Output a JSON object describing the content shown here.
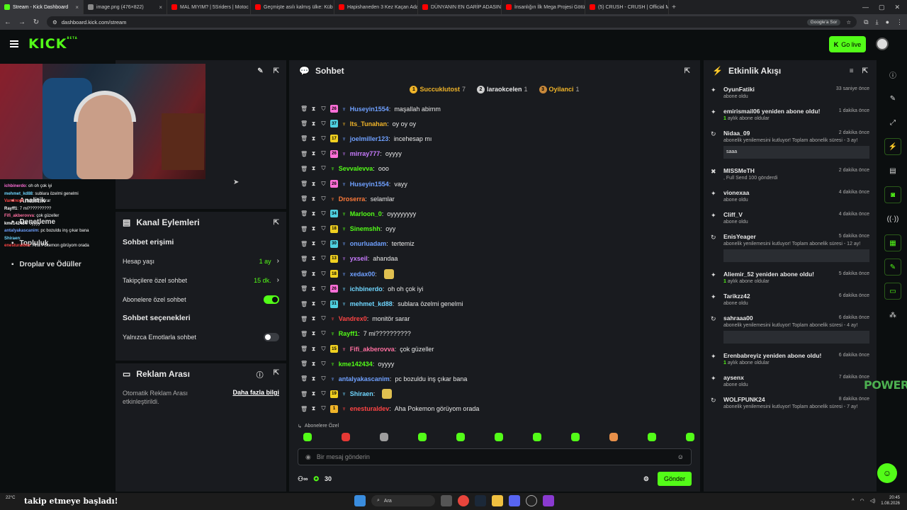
{
  "browser": {
    "tabs": [
      {
        "title": "Stream - Kick Dashboard",
        "color": "#53fc18",
        "active": true
      },
      {
        "title": "image.png (476×822)",
        "color": "#888888",
        "active": false
      },
      {
        "title": "MAL MIYIM? | 5Sriders | Motoc",
        "color": "#ff0000",
        "active": false
      },
      {
        "title": "Geçmişte asılı kalmış ülke: Küb",
        "color": "#ff0000",
        "active": false
      },
      {
        "title": "Hapishaneden 3 Kez Kaçan Ada",
        "color": "#ff0000",
        "active": false
      },
      {
        "title": "DÜNYANIN EN GARİP ADASINI",
        "color": "#ff0000",
        "active": false
      },
      {
        "title": "İnsanlığın İlk Mega Projesi Götü",
        "color": "#ff0000",
        "active": false
      },
      {
        "title": "(5) CRUSH - CRUSH | Official M",
        "color": "#ff0000",
        "active": false
      }
    ],
    "url": "dashboard.kick.com/stream",
    "google_sor": "Google'a Sor"
  },
  "header": {
    "logo": "KICK",
    "logo_sup": "BETA",
    "go_live": "Go live"
  },
  "left_menu": [
    "Analitik",
    "Denetleme",
    "Topluluk",
    "Droplar ve Ödüller"
  ],
  "overlay_chat": [
    {
      "user": "ichbinerdo",
      "text": "oh oh çok iyi",
      "color": "#ff6fd8"
    },
    {
      "user": "mehmet_kd88",
      "text": "sublara özelmi genelmi",
      "color": "#6fd6ff"
    },
    {
      "user": "Vandrex0",
      "text": "monitör sarar",
      "color": "#ff4444"
    },
    {
      "user": "Rayff1",
      "text": "7 mi??????????",
      "color": "#ffffff"
    },
    {
      "user": "Fifi_akberovva",
      "text": "çok güzeller",
      "color": "#ff6fa0"
    },
    {
      "user": "kme142434",
      "text": "oyyyy",
      "color": "#ffffff"
    },
    {
      "user": "antalyakascanim",
      "text": "pc bozuldu inş çıkar bana",
      "color": "#6fa0ff"
    },
    {
      "user": "Shiraen",
      "text": "",
      "color": "#6fd6ff"
    },
    {
      "user": "enesturaldev",
      "text": "Aha Pokemon görüyom orada",
      "color": "#ff4444"
    }
  ],
  "channel_actions": {
    "title": "Kanal Eylemleri",
    "chat_access": "Sohbet erişimi",
    "account_age_label": "Hesap yaşı",
    "account_age_value": "1 ay",
    "followers_label": "Takipçilere özel sohbet",
    "followers_value": "15 dk.",
    "subs_label": "Abonelere özel sohbet",
    "chat_options": "Sohbet seçenekleri",
    "emote_only_label": "Yalnızca Emotlarla sohbet"
  },
  "ad_break": {
    "title": "Reklam Arası",
    "desc": "Otomatik Reklam Arası etkinleştirildi.",
    "link": "Daha fazla bilgi"
  },
  "chat": {
    "title": "Sohbet",
    "gifters": [
      {
        "rank": "1",
        "name": "Succuklutost",
        "count": "7",
        "color": "#f0b429",
        "name_color": "#f0b429"
      },
      {
        "rank": "2",
        "name": "laraokcelen",
        "count": "1",
        "color": "#cfcfcf",
        "name_color": "#e8e8e8"
      },
      {
        "rank": "3",
        "name": "Oyilanci",
        "count": "1",
        "color": "#c8883a",
        "name_color": "#f0b429"
      }
    ],
    "messages": [
      {
        "badge": "26",
        "badge_color": "#ff6fd8",
        "user": "Huseyin1554",
        "user_color": "#6fa0ff",
        "text": "maşallah abimm"
      },
      {
        "badge": "37",
        "badge_color": "#4fd0e0",
        "user": "Its_Tunahan",
        "user_color": "#f0b429",
        "text": "oy oy oy"
      },
      {
        "badge": "17",
        "badge_color": "#f0d020",
        "user": "joelmiller123",
        "user_color": "#6fa0ff",
        "text": "incehesap mı"
      },
      {
        "badge": "26",
        "badge_color": "#ff6fd8",
        "user": "mirray777",
        "user_color": "#c97bff",
        "text": "oyyyy"
      },
      {
        "badge": "",
        "badge_color": "",
        "user": "Sevvalevva",
        "user_color": "#53fc18",
        "text": "ooo"
      },
      {
        "badge": "26",
        "badge_color": "#ff6fd8",
        "user": "Huseyin1554",
        "user_color": "#6fa0ff",
        "text": "vayy"
      },
      {
        "badge": "",
        "badge_color": "",
        "user": "Droserra",
        "user_color": "#ff7a3a",
        "text": "selamlar"
      },
      {
        "badge": "34",
        "badge_color": "#4fd0e0",
        "user": "Marloon_0",
        "user_color": "#53fc18",
        "text": "oyyyyyyyy"
      },
      {
        "badge": "18",
        "badge_color": "#f0d020",
        "user": "Sinemshh",
        "user_color": "#53fc18",
        "text": "oyy"
      },
      {
        "badge": "30",
        "badge_color": "#4fd0e0",
        "user": "onurluadam",
        "user_color": "#6fa0ff",
        "text": "tertemiz"
      },
      {
        "badge": "13",
        "badge_color": "#f0d020",
        "user": "yxseil",
        "user_color": "#c97bff",
        "text": "ahandaa"
      },
      {
        "badge": "18",
        "badge_color": "#f0d020",
        "user": "xedax00",
        "user_color": "#6fa0ff",
        "text": ""
      },
      {
        "badge": "26",
        "badge_color": "#ff6fd8",
        "user": "ichbinerdo",
        "user_color": "#6fd6ff",
        "text": "oh oh çok iyi"
      },
      {
        "badge": "31",
        "badge_color": "#4fd0e0",
        "user": "mehmet_kd88",
        "user_color": "#6fd6ff",
        "text": "sublara özelmi genelmi"
      },
      {
        "badge": "",
        "badge_color": "",
        "user": "Vandrex0",
        "user_color": "#ff4444",
        "text": "monitör sarar"
      },
      {
        "badge": "",
        "badge_color": "",
        "user": "Rayff1",
        "user_color": "#53fc18",
        "text": "7 mi??????????"
      },
      {
        "badge": "15",
        "badge_color": "#f0d020",
        "user": "Fifi_akberovva",
        "user_color": "#ff6fa0",
        "text": "çok güzeller"
      },
      {
        "badge": "",
        "badge_color": "",
        "user": "kme142434",
        "user_color": "#53fc18",
        "text": "oyyyy"
      },
      {
        "badge": "",
        "badge_color": "",
        "user": "antalyakascanim",
        "user_color": "#6fa0ff",
        "text": "pc bozuldu inş çıkar bana"
      },
      {
        "badge": "19",
        "badge_color": "#f0d020",
        "user": "Shiraen",
        "user_color": "#6fd6ff",
        "text": ""
      },
      {
        "badge": "1",
        "badge_color": "#f0b429",
        "user": "enesturaldev",
        "user_color": "#ff4444",
        "text": "Aha Pokemon görüyom orada"
      }
    ],
    "sub_mode": "Abonelere Özel",
    "placeholder": "Bir mesaj gönderin",
    "kicks": "30",
    "send": "Gönder"
  },
  "feed": {
    "title": "Etkinlik Akışı",
    "events": [
      {
        "icon": "star",
        "name": "OyunFatiki",
        "time": "33 saniye önce",
        "sub": "abone oldu",
        "months": "",
        "quote": ""
      },
      {
        "icon": "star",
        "name": "emirismail06 yeniden abone oldu!",
        "time": "1 dakika önce",
        "sub": "aylık abone oldular",
        "months": "1",
        "quote": ""
      },
      {
        "icon": "resub",
        "name": "Nidaa_09",
        "time": "2 dakika önce",
        "sub": "abonelik yenilemesini kutluyor! Toplam abonelik süresi - 3 ay!",
        "months": "",
        "quote": "saaa"
      },
      {
        "icon": "kick",
        "name": "MISSMeTH",
        "time": "2 dakika önce",
        "sub": ", Full Send  100 gönderdi",
        "months": "",
        "quote": ""
      },
      {
        "icon": "star",
        "name": "vionexaa",
        "time": "4 dakika önce",
        "sub": "abone oldu",
        "months": "",
        "quote": ""
      },
      {
        "icon": "star",
        "name": "Cliff_V",
        "time": "4 dakika önce",
        "sub": "abone oldu",
        "months": "",
        "quote": ""
      },
      {
        "icon": "resub",
        "name": "EnisYeager",
        "time": "5 dakika önce",
        "sub": "abonelik yenilemesini kutluyor! Toplam abonelik süresi - 12 ay!",
        "months": "",
        "quote": " "
      },
      {
        "icon": "star",
        "name": "Aliemir_52 yeniden abone oldu!",
        "time": "5 dakika önce",
        "sub": "aylık abone oldular",
        "months": "1",
        "quote": ""
      },
      {
        "icon": "star",
        "name": "Tarikzz42",
        "time": "6 dakika önce",
        "sub": "abone oldu",
        "months": "",
        "quote": ""
      },
      {
        "icon": "resub",
        "name": "sahraaa00",
        "time": "6 dakika önce",
        "sub": "abonelik yenilemesini kutluyor! Toplam abonelik süresi - 4 ay!",
        "months": "",
        "quote": " "
      },
      {
        "icon": "star",
        "name": "Erenbabreyiz yeniden abone oldu!",
        "time": "6 dakika önce",
        "sub": "aylık abone oldular",
        "months": "1",
        "quote": ""
      },
      {
        "icon": "star",
        "name": "aysenx",
        "time": "7 dakika önce",
        "sub": "abone oldu",
        "months": "",
        "quote": ""
      },
      {
        "icon": "resub",
        "name": "WOLFPUNK24",
        "time": "8 dakika önce",
        "sub": "abonelik yenilemesini kutluyor! Toplam abonelik süresi - 7 ay!",
        "months": "",
        "quote": ""
      }
    ]
  },
  "overlay": {
    "power": "POWER",
    "follow": "takip etmeye başladı!"
  },
  "taskbar": {
    "search": "Ara",
    "weather": "22°C",
    "time": "20:45",
    "date": "1.08.2026"
  }
}
